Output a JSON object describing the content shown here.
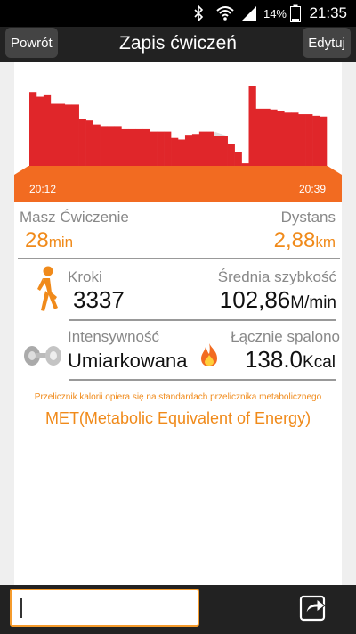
{
  "status_bar": {
    "time": "21:35",
    "battery_percent": "14%",
    "icons": [
      "bluetooth-icon",
      "wifi-icon",
      "signal-icon",
      "battery-icon"
    ]
  },
  "header": {
    "back_label": "Powrót",
    "title": "Zapis ćwiczeń",
    "edit_label": "Edytuj"
  },
  "chart_data": {
    "type": "bar",
    "start_label": "20:12",
    "end_label": "20:39",
    "values": [
      100,
      94,
      97,
      85,
      85,
      84,
      84,
      66,
      64,
      59,
      57,
      57,
      57,
      53,
      53,
      53,
      53,
      50,
      50,
      50,
      42,
      40,
      46,
      47,
      50,
      50,
      45,
      45,
      34,
      24,
      10,
      107,
      79,
      79,
      78,
      76,
      74,
      74,
      72,
      72,
      70,
      69
    ],
    "colors": {
      "bars": "#e0262a",
      "band": "#f26b21",
      "ghost": "#dedede"
    }
  },
  "stats": {
    "duration": {
      "label": "Masz Ćwiczenie",
      "value": "28",
      "unit": "min"
    },
    "distance": {
      "label": "Dystans",
      "value": "2,88",
      "unit": "km"
    },
    "steps": {
      "label": "Kroki",
      "value": "3337"
    },
    "speed": {
      "label": "Średnia szybkość",
      "value": "102,86",
      "unit": "M/min"
    },
    "intensity": {
      "label": "Intensywność",
      "value": "Umiarkowana"
    },
    "calories": {
      "label": "Łącznie spalono",
      "value": "138.0",
      "unit": "Kcal"
    }
  },
  "note": {
    "line1": "Przelicznik kalorii opiera się na standardach przelicznika metabolicznego",
    "line2": "MET(Metabolic Equivalent of Energy)"
  },
  "bottom": {
    "input_value": ""
  },
  "colors": {
    "accent": "#f08a1a",
    "header_bg": "#222222"
  }
}
